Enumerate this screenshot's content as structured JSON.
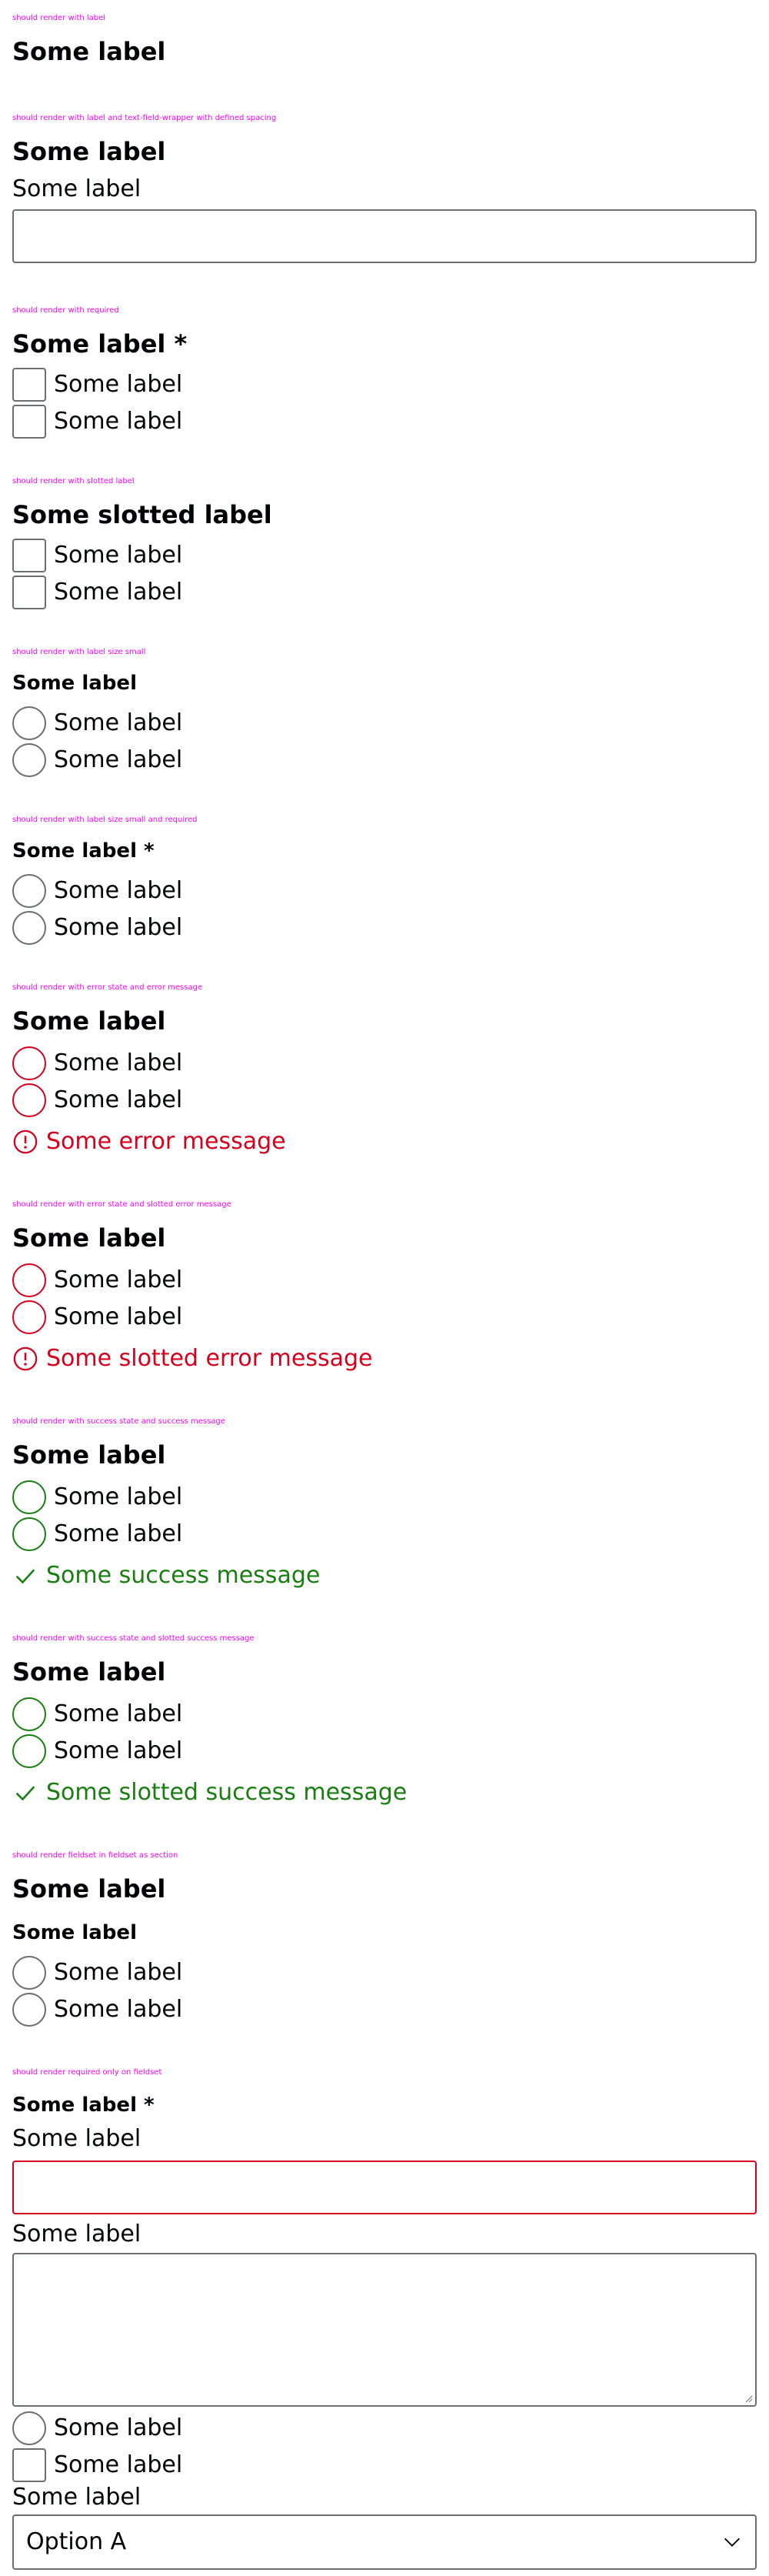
{
  "sections": {
    "s1": {
      "caption": "should render with label",
      "legend": "Some label"
    },
    "s2": {
      "caption": "should render with label and text-field-wrapper with defined spacing",
      "legend": "Some label",
      "field_label": "Some label"
    },
    "s3": {
      "caption": "should render with required",
      "legend": "Some label *",
      "options": [
        "Some label",
        "Some label"
      ]
    },
    "s4": {
      "caption": "should render with slotted label",
      "legend": "Some slotted label",
      "options": [
        "Some label",
        "Some label"
      ]
    },
    "s5": {
      "caption": "should render with label size small",
      "legend": "Some label",
      "options": [
        "Some label",
        "Some label"
      ]
    },
    "s6": {
      "caption": "should render with label size small and required",
      "legend": "Some label *",
      "options": [
        "Some label",
        "Some label"
      ]
    },
    "s7": {
      "caption": "should render with error state and error message",
      "legend": "Some label",
      "options": [
        "Some label",
        "Some label"
      ],
      "message": "Some error message"
    },
    "s8": {
      "caption": "should render with error state and slotted error message",
      "legend": "Some label",
      "options": [
        "Some label",
        "Some label"
      ],
      "message": "Some slotted error message"
    },
    "s9": {
      "caption": "should render with success state and success message",
      "legend": "Some label",
      "options": [
        "Some label",
        "Some label"
      ],
      "message": "Some success message"
    },
    "s10": {
      "caption": "should render with success state and slotted success message",
      "legend": "Some label",
      "options": [
        "Some label",
        "Some label"
      ],
      "message": "Some slotted success message"
    },
    "s11": {
      "caption": "should render fieldset in fieldset as section",
      "legend": "Some label",
      "inner_legend": "Some label",
      "options": [
        "Some label",
        "Some label"
      ]
    },
    "s12": {
      "caption": "should render required only on fieldset",
      "legend": "Some label *",
      "input_label": "Some label",
      "textarea_label": "Some label",
      "radio_label": "Some label",
      "checkbox_label": "Some label",
      "select_label": "Some label",
      "select_value": "Option A"
    }
  },
  "colors": {
    "caption": "#ff00ff",
    "text": "#010205",
    "border": "#6b6d70",
    "error": "#d5001c",
    "success": "#197e10"
  },
  "icons": {
    "error": "exclamation-circle-icon",
    "success": "check-icon",
    "select": "chevron-down-icon"
  }
}
